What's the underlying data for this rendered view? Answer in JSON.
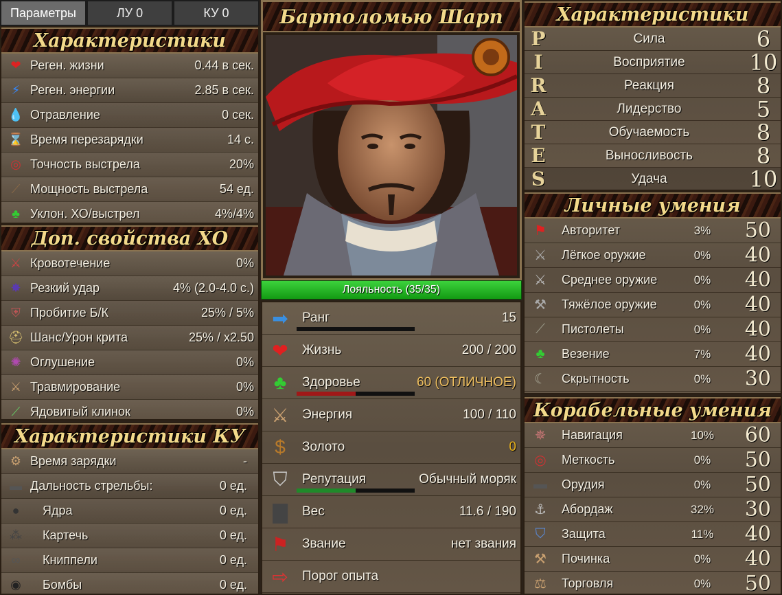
{
  "tabs": [
    {
      "label": "Параметры"
    },
    {
      "label": "ЛУ 0"
    },
    {
      "label": "КУ 0"
    }
  ],
  "characteristics": {
    "title": "Характеристики",
    "items": [
      {
        "label": "Реген. жизни",
        "value": "0.44 в сек.",
        "icon": "heart-regen-icon"
      },
      {
        "label": "Реген. энергии",
        "value": "2.85 в сек.",
        "icon": "energy-regen-icon"
      },
      {
        "label": "Отравление",
        "value": "0 сек.",
        "icon": "poison-drop-icon"
      },
      {
        "label": "Время перезарядки",
        "value": "14 с.",
        "icon": "hourglass-icon"
      },
      {
        "label": "Точность выстрела",
        "value": "20%",
        "icon": "target-icon"
      },
      {
        "label": "Мощность выстрела",
        "value": "54 ед.",
        "icon": "musket-icon"
      },
      {
        "label": "Уклон. ХО/выстрел",
        "value": "4%/4%",
        "icon": "clover-icon"
      }
    ]
  },
  "extra": {
    "title": "Доп. свойства ХО",
    "items": [
      {
        "label": "Кровотечение",
        "value": "0%",
        "icon": "bleed-sword-icon"
      },
      {
        "label": "Резкий удар",
        "value": "4% (2.0-4.0 с.)",
        "icon": "strike-icon"
      },
      {
        "label": "Пробитие Б/К",
        "value": "25% / 5%",
        "icon": "armor-pierce-icon"
      },
      {
        "label": "Шанс/Урон крита",
        "value": "25% / x2.50",
        "icon": "helmet-icon"
      },
      {
        "label": "Оглушение",
        "value": "0%",
        "icon": "stun-icon"
      },
      {
        "label": "Травмирование",
        "value": "0%",
        "icon": "crossed-swords-icon"
      },
      {
        "label": "Ядовитый клинок",
        "value": "0%",
        "icon": "poison-blade-icon"
      }
    ]
  },
  "firearm": {
    "title": "Характеристики КУ",
    "items": [
      {
        "label": "Время зарядки",
        "value": "-",
        "icon": "cannon-reload-icon"
      },
      {
        "label": "Дальность стрельбы:",
        "value": "0 ед.",
        "icon": "cannon-icon"
      },
      {
        "label": "Ядра",
        "value": "0 ед.",
        "icon": "cannonballs-icon"
      },
      {
        "label": "Картечь",
        "value": "0 ед.",
        "icon": "grapeshot-icon"
      },
      {
        "label": "Книппели",
        "value": "0 ед.",
        "icon": "chainshot-icon"
      },
      {
        "label": "Бомбы",
        "value": "0 ед.",
        "icon": "bombs-icon"
      }
    ]
  },
  "hero": {
    "name": "Бартоломью Шарп",
    "loyalty": "Лояльность (35/35)"
  },
  "status": [
    {
      "label": "Ранг",
      "value": "15",
      "icon": "arrow-right-icon",
      "bar": null
    },
    {
      "label": "Жизнь",
      "value": "200 / 200",
      "icon": "heart-icon",
      "bar": null
    },
    {
      "label": "Здоровье",
      "value": "60 (ОТЛИЧНОЕ)",
      "icon": "clover-icon",
      "bar": {
        "fill": 0.5,
        "color": "#a01818"
      }
    },
    {
      "label": "Энергия",
      "value": "100 / 110",
      "icon": "crossed-swords-icon",
      "bar": null
    },
    {
      "label": "Золото",
      "value": "0",
      "icon": "gold-bag-icon",
      "bar": null
    },
    {
      "label": "Репутация",
      "value": "Обычный моряк",
      "icon": "shield-icon",
      "bar": {
        "fill": 0.5,
        "color": "#1f8a2a"
      }
    },
    {
      "label": "Вес",
      "value": "11.6 / 190",
      "icon": "weight-icon",
      "bar": null
    },
    {
      "label": "Звание",
      "value": "нет звания",
      "icon": "flag-icon",
      "bar": null
    },
    {
      "label": "Порог опыта",
      "value": "",
      "icon": "experience-arrow-icon",
      "bar": null
    }
  ],
  "rank_bar": {
    "fill": 0.0
  },
  "gold_color": "#e8b21c",
  "pirates": {
    "title": "Характеристики",
    "items": [
      {
        "letter": "P",
        "name": "Сила",
        "value": "6"
      },
      {
        "letter": "I",
        "name": "Восприятие",
        "value": "10"
      },
      {
        "letter": "R",
        "name": "Реакция",
        "value": "8"
      },
      {
        "letter": "A",
        "name": "Лидерство",
        "value": "5"
      },
      {
        "letter": "T",
        "name": "Обучаемость",
        "value": "8"
      },
      {
        "letter": "E",
        "name": "Выносливость",
        "value": "8"
      },
      {
        "letter": "S",
        "name": "Удача",
        "value": "10"
      }
    ]
  },
  "personal": {
    "title": "Личные умения",
    "items": [
      {
        "name": "Авторитет",
        "pct": "3%",
        "value": "50",
        "icon": "red-flag-icon"
      },
      {
        "name": "Лёгкое оружие",
        "pct": "0%",
        "value": "40",
        "icon": "light-sword-icon"
      },
      {
        "name": "Среднее оружие",
        "pct": "0%",
        "value": "40",
        "icon": "medium-sword-icon"
      },
      {
        "name": "Тяжёлое оружие",
        "pct": "0%",
        "value": "40",
        "icon": "heavy-axe-icon"
      },
      {
        "name": "Пистолеты",
        "pct": "0%",
        "value": "40",
        "icon": "pistols-icon"
      },
      {
        "name": "Везение",
        "pct": "7%",
        "value": "40",
        "icon": "clover-icon"
      },
      {
        "name": "Скрытность",
        "pct": "0%",
        "value": "30",
        "icon": "mask-icon"
      }
    ]
  },
  "ship": {
    "title": "Корабельные умения",
    "items": [
      {
        "name": "Навигация",
        "pct": "10%",
        "value": "60",
        "icon": "compass-icon"
      },
      {
        "name": "Меткость",
        "pct": "0%",
        "value": "50",
        "icon": "target-icon"
      },
      {
        "name": "Орудия",
        "pct": "0%",
        "value": "50",
        "icon": "cannon-icon"
      },
      {
        "name": "Абордаж",
        "pct": "32%",
        "value": "30",
        "icon": "grappling-hook-icon"
      },
      {
        "name": "Защита",
        "pct": "11%",
        "value": "40",
        "icon": "shield-blue-icon"
      },
      {
        "name": "Починка",
        "pct": "0%",
        "value": "40",
        "icon": "hammer-icon"
      },
      {
        "name": "Торговля",
        "pct": "0%",
        "value": "50",
        "icon": "trade-bag-icon"
      }
    ]
  }
}
